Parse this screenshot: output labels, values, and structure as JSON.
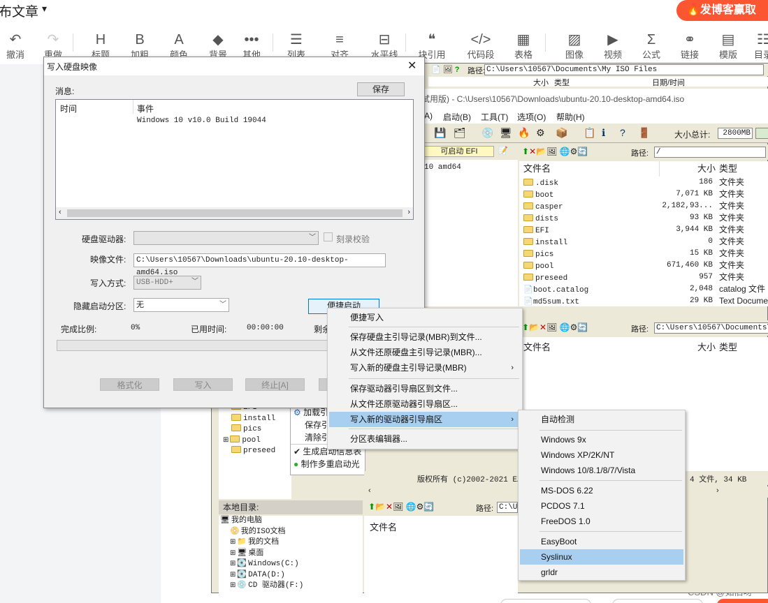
{
  "csdn": {
    "page_title": "布文章",
    "promo": "发博客赢取",
    "toolbar": [
      {
        "icon": "↶",
        "label": "撤消"
      },
      {
        "icon": "↷",
        "label": "重做"
      },
      {
        "icon": "H",
        "label": "标题"
      },
      {
        "icon": "B",
        "label": "加粗"
      },
      {
        "icon": "A",
        "label": "颜色"
      },
      {
        "icon": "◆",
        "label": "背景"
      },
      {
        "icon": "•••",
        "label": "其他"
      },
      {
        "icon": "☰",
        "label": "列表"
      },
      {
        "icon": "≡",
        "label": "对齐"
      },
      {
        "icon": "⊟",
        "label": "水平线"
      },
      {
        "icon": "❝",
        "label": "块引用"
      },
      {
        "icon": "</>",
        "label": "代码段"
      },
      {
        "icon": "▦",
        "label": "表格"
      },
      {
        "icon": "▨",
        "label": "图像"
      },
      {
        "icon": "▶",
        "label": "视频"
      },
      {
        "icon": "Σ",
        "label": "公式"
      },
      {
        "icon": "⚭",
        "label": "链接"
      },
      {
        "icon": "▤",
        "label": "模版"
      },
      {
        "icon": "☷",
        "label": "目录"
      }
    ],
    "watermark": "CSDN @如旧呀"
  },
  "ultraiso": {
    "top_path_label": "路径:",
    "top_path": "C:\\Users\\10567\\Documents\\My ISO Files",
    "top_cols": [
      "大小",
      "类型",
      "日期/时间"
    ],
    "window_title": "试用版) - C:\\Users\\10567\\Downloads\\ubuntu-20.10-desktop-amd64.iso",
    "menubar": [
      "A)",
      "启动(B)",
      "工具(T)",
      "选项(O)",
      "帮助(H)"
    ],
    "size_total_label": "大小总计:",
    "size_total": "2800MB",
    "bootable": "可启动 EFI",
    "image_path_label": "路径:",
    "image_path": "/",
    "tree_root_fragment": "10 amd64",
    "image_cols": {
      "name": "文件名",
      "size": "大小",
      "type": "类型"
    },
    "image_files": [
      {
        "name": ".disk",
        "size": "186",
        "type": "文件夹"
      },
      {
        "name": "boot",
        "size": "7,071 KB",
        "type": "文件夹"
      },
      {
        "name": "casper",
        "size": "2,182,93...",
        "type": "文件夹"
      },
      {
        "name": "dists",
        "size": "93 KB",
        "type": "文件夹"
      },
      {
        "name": "EFI",
        "size": "3,944 KB",
        "type": "文件夹"
      },
      {
        "name": "install",
        "size": "0",
        "type": "文件夹"
      },
      {
        "name": "pics",
        "size": "15 KB",
        "type": "文件夹"
      },
      {
        "name": "pool",
        "size": "671,460 KB",
        "type": "文件夹"
      },
      {
        "name": "preseed",
        "size": "957",
        "type": "文件夹"
      },
      {
        "name": "boot.catalog",
        "size": "2,048",
        "type": "catalog 文件"
      },
      {
        "name": "md5sum.txt",
        "size": "29 KB",
        "type": "Text Document"
      }
    ],
    "lower_path_label": "路径:",
    "lower_path": "C:\\Users\\10567\\Documents\\My",
    "lower_cols": {
      "name": "文件名",
      "size": "大小",
      "type": "类型"
    },
    "tree_items": [
      "EFI",
      "install",
      "pics",
      "pool",
      "preseed"
    ],
    "boot_panel": [
      "加载引",
      "保存引",
      "清除引",
      "生成启动信息表",
      "制作多重启动光"
    ],
    "copyright": "版权所有 (c)2002-2021 EZ",
    "status": "4 文件, 34 KB",
    "local_dir_label": "本地目录:",
    "local_path_label": "路径:",
    "local_path": "C:\\Us",
    "local_tree": [
      "我的电脑",
      "我的ISO文档",
      "我的文档",
      "桌面",
      "Windows(C:)",
      "DATA(D:)",
      "CD 驱动器(F:)"
    ],
    "local_col_name": "文件名"
  },
  "dialog": {
    "title": "写入硬盘映像",
    "close": "✕",
    "messages_label": "消息:",
    "save_button": "保存",
    "col_time": "时间",
    "col_event": "事件",
    "log_line": "Windows 10 v10.0 Build 19044",
    "drive_label": "硬盘驱动器:",
    "verify_label": "刻录校验",
    "image_file_label": "映像文件:",
    "image_file": "C:\\Users\\10567\\Downloads\\ubuntu-20.10-desktop-amd64.iso",
    "write_mode_label": "写入方式:",
    "write_mode": "USB-HDD+",
    "hidden_part_label": "隐藏启动分区:",
    "hidden_part": "无",
    "quick_boot_button": "便捷启动",
    "progress_label": "完成比例:",
    "progress_value": "0%",
    "elapsed_label": "已用时间:",
    "elapsed": "00:00:00",
    "remaining_label": "剩余",
    "progress_fraction": 0,
    "buttons": [
      "格式化",
      "写入",
      "终止[A]"
    ]
  },
  "menu": {
    "items": [
      {
        "label": "便捷写入"
      },
      {
        "label": "保存硬盘主引导记录(MBR)到文件..."
      },
      {
        "label": "从文件还原硬盘主引导记录(MBR)..."
      },
      {
        "label": "写入新的硬盘主引导记录(MBR)",
        "arrow": "›"
      },
      {
        "label": "保存驱动器引导扇区到文件..."
      },
      {
        "label": "从文件还原驱动器引导扇区..."
      },
      {
        "label": "写入新的驱动器引导扇区",
        "arrow": "›"
      },
      {
        "label": "分区表编辑器..."
      }
    ]
  },
  "submenu": {
    "items": [
      "自动检测",
      "Windows 9x",
      "Windows XP/2K/NT",
      "Windows 10/8.1/8/7/Vista",
      "MS-DOS 6.22",
      "PCDOS 7.1",
      "FreeDOS 1.0",
      "EasyBoot",
      "Syslinux",
      "grldr"
    ],
    "highlighted": "Syslinux"
  }
}
